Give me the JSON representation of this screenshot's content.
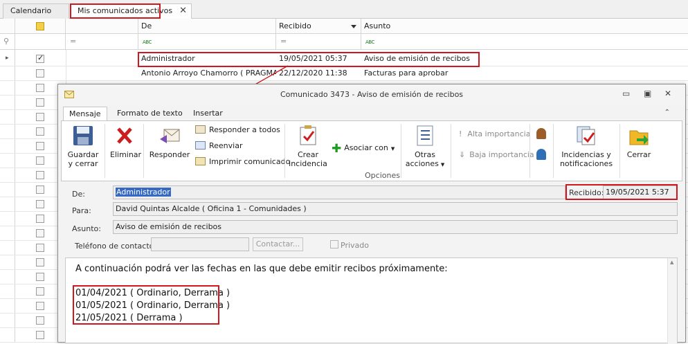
{
  "tabs": [
    {
      "label": "Calendario"
    },
    {
      "label": "Mis comunicados activos"
    }
  ],
  "grid": {
    "columns": {
      "de": "De",
      "recibido": "Recibido",
      "asunto": "Asunto"
    },
    "filter_eq": "=",
    "filter_abc": "ABC",
    "rows": [
      {
        "checked": true,
        "de": "Administrador",
        "recibido": "19/05/2021 05:37",
        "asunto": "Aviso de emisión de recibos"
      },
      {
        "checked": false,
        "de": "Antonio Arroyo Chamorro ( PRAGMA -...",
        "recibido": "22/12/2020 11:38",
        "asunto": "Facturas para aprobar"
      }
    ]
  },
  "window": {
    "title": "Comunicado 3473 - Aviso de emisión de recibos",
    "ribbon_tabs": [
      "Mensaje",
      "Formato de texto",
      "Insertar"
    ],
    "ribbon": {
      "guardar_l1": "Guardar",
      "guardar_l2": "y cerrar",
      "eliminar": "Eliminar",
      "responder": "Responder",
      "responder_todos": "Responder a todos",
      "reenviar": "Reenviar",
      "imprimir": "Imprimir comunicado",
      "crear_l1": "Crear",
      "crear_l2": "incidencia",
      "asociar": "Asociar con",
      "otras_l1": "Otras",
      "otras_l2": "acciones",
      "alta": "Alta importancia",
      "baja": "Baja importancia",
      "incid_l1": "Incidencias y",
      "incid_l2": "notificaciones",
      "cerrar": "Cerrar",
      "group_label": "Opciones"
    },
    "form": {
      "de_label": "De:",
      "de_value": "Administrador",
      "recibido_label": "Recibido:",
      "recibido_value": "19/05/2021 5:37",
      "para_label": "Para:",
      "para_value": "David Quintas Alcalde ( Oficina 1 - Comunidades )",
      "asunto_label": "Asunto:",
      "asunto_value": "Aviso de emisión de recibos",
      "telefono_label": "Teléfono de contacto:",
      "telefono_value": "",
      "contactar": "Contactar...",
      "privado": "Privado"
    },
    "body": {
      "intro": "A continuación podrá ver las fechas en las que debe emitir recibos próximamente:",
      "lines": [
        "01/04/2021 ( Ordinario, Derrama )",
        "01/05/2021 ( Ordinario, Derrama )",
        "21/05/2021 ( Derrama )"
      ]
    }
  },
  "colors": {
    "highlight": "#d0161e",
    "selection": "#3569c4"
  }
}
